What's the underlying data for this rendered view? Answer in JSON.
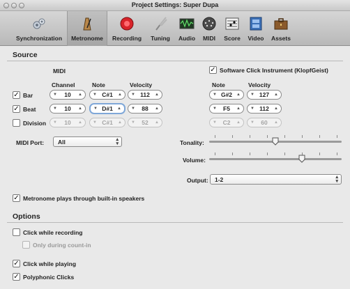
{
  "window": {
    "title": "Project Settings: Super Dupa"
  },
  "toolbar": {
    "items": [
      {
        "label": "Synchronization",
        "icon": "gears-icon"
      },
      {
        "label": "Metronome",
        "icon": "metronome-icon",
        "selected": true
      },
      {
        "label": "Recording",
        "icon": "record-icon"
      },
      {
        "label": "Tuning",
        "icon": "tuning-fork-icon"
      },
      {
        "label": "Audio",
        "icon": "waveform-icon"
      },
      {
        "label": "MIDI",
        "icon": "midi-plug-icon"
      },
      {
        "label": "Score",
        "icon": "score-icon"
      },
      {
        "label": "Video",
        "icon": "film-icon"
      },
      {
        "label": "Assets",
        "icon": "briefcase-icon"
      }
    ]
  },
  "source": {
    "heading": "Source",
    "midi_heading": "MIDI",
    "col_channel": "Channel",
    "col_note": "Note",
    "col_velocity": "Velocity",
    "rows": [
      {
        "label": "Bar",
        "checked": true,
        "channel": "10",
        "note": "C#1",
        "velocity": "112"
      },
      {
        "label": "Beat",
        "checked": true,
        "channel": "10",
        "note": "D#1",
        "velocity": "88"
      },
      {
        "label": "Division",
        "checked": false,
        "channel": "10",
        "note": "C#1",
        "velocity": "52"
      }
    ],
    "midi_port_label": "MIDI Port:",
    "midi_port_value": "All",
    "software_click": {
      "label": "Software Click Instrument (KlopfGeist)",
      "checked": true,
      "col_note": "Note",
      "col_velocity": "Velocity",
      "rows": [
        {
          "note": "G#2",
          "velocity": "127"
        },
        {
          "note": "F5",
          "velocity": "112"
        },
        {
          "note": "C2",
          "velocity": "60"
        }
      ]
    },
    "tonality_label": "Tonality:",
    "tonality_level": 0.5,
    "volume_label": "Volume:",
    "volume_level": 0.7,
    "output_label": "Output:",
    "output_value": "1-2",
    "builtin_speakers": {
      "label": "Metronome plays through built-in speakers",
      "checked": true
    }
  },
  "options": {
    "heading": "Options",
    "click_recording": {
      "label": "Click while recording",
      "checked": false
    },
    "count_in": {
      "label": "Only during count-in",
      "checked": false
    },
    "click_playing": {
      "label": "Click while playing",
      "checked": true
    },
    "polyphonic": {
      "label": "Polyphonic Clicks",
      "checked": true
    }
  },
  "glyphs": {
    "check": "✓",
    "up": "▲",
    "down": "▼"
  }
}
